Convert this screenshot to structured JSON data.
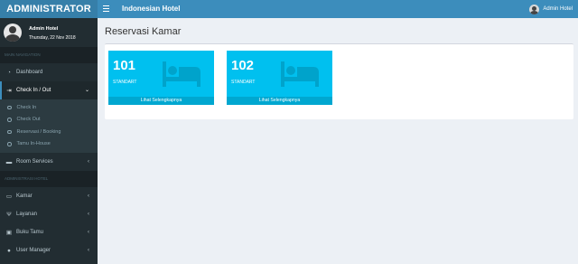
{
  "logo": {
    "text": "ADMINISTRATOR"
  },
  "topbar": {
    "brand": "Indonesian Hotel",
    "user": "Admin Hotel"
  },
  "user_panel": {
    "name": "Admin Hotel",
    "date": "Thursday, 22 Nov 2018"
  },
  "sidebar": {
    "main_header": "MAIN NAVIGATION",
    "dashboard": {
      "label": "Dashboard",
      "icon": "dashboard-icon"
    },
    "checkin_out": {
      "label": "Check In / Out",
      "icon": "sign-in-icon",
      "children": [
        "Check In",
        "Check Out",
        "Reservasi / Booking",
        "Tamu In-House"
      ]
    },
    "room_services": {
      "label": "Room Services",
      "icon": "bell-icon"
    },
    "admin_header": "ADMINISTRASI HOTEL",
    "kamar": {
      "label": "Kamar",
      "icon": "bed-icon"
    },
    "layanan": {
      "label": "Layanan",
      "icon": "cutlery-icon"
    },
    "buku_tamu": {
      "label": "Buku Tamu",
      "icon": "briefcase-icon"
    },
    "user_manager": {
      "label": "User Manager",
      "icon": "user-icon"
    }
  },
  "content": {
    "title": "Reservasi Kamar",
    "rooms": [
      {
        "number": "101",
        "type": "STANDART",
        "link": "Lihat Selengkapnya",
        "icon": "bed-icon"
      },
      {
        "number": "102",
        "type": "STANDART",
        "link": "Lihat Selengkapnya",
        "icon": "bed-icon"
      }
    ]
  },
  "colors": {
    "topbar": "#3c8dbc",
    "logo": "#367fa9",
    "sidebar": "#222d32",
    "tile": "#00c0ef",
    "tile_footer": "#00a7d0"
  }
}
